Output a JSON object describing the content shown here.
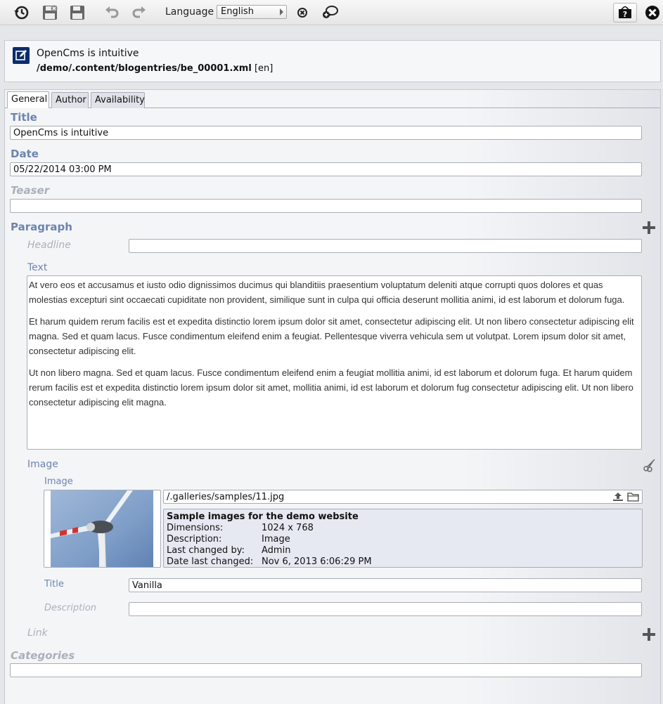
{
  "toolbar": {
    "language_label": "Language",
    "language_value": "English"
  },
  "header": {
    "title": "OpenCms is intuitive",
    "path": "/demo/.content/blogentries/be_00001.xml",
    "locale": "[en]"
  },
  "tabs": [
    {
      "label": "General",
      "active": true
    },
    {
      "label": "Author"
    },
    {
      "label": "Availability"
    }
  ],
  "fields": {
    "title_label": "Title",
    "title_value": "OpenCms is intuitive",
    "date_label": "Date",
    "date_value": "05/22/2014 03:00 PM",
    "teaser_label": "Teaser",
    "teaser_value": "",
    "paragraph_label": "Paragraph",
    "headline_label": "Headline",
    "headline_value": "",
    "text_label": "Text",
    "text_paragraphs": [
      "At vero eos et accusamus et iusto odio dignissimos ducimus qui blanditiis praesentium voluptatum deleniti atque corrupti quos dolores et quas molestias excepturi sint occaecati cupiditate non provident, similique sunt in culpa qui officia deserunt mollitia animi, id est laborum et dolorum fuga.",
      "Et harum quidem rerum facilis est et expedita distinctio lorem ipsum dolor sit amet, consectetur adipiscing elit. Ut non libero consectetur adipiscing elit magna. Sed et quam lacus. Fusce condimentum eleifend enim a feugiat. Pellentesque viverra vehicula sem ut volutpat. Lorem ipsum dolor sit amet, consectetur adipiscing elit.",
      "Ut non libero magna. Sed et quam lacus. Fusce condimentum eleifend enim a feugiat mollitia animi, id est laborum et dolorum fuga. Et harum quidem rerum facilis est et expedita distinctio lorem ipsum dolor sit amet, mollitia animi, id est laborum et dolorum fug consectetur adipiscing elit. Ut non libero consectetur adipiscing elit magna."
    ],
    "image_group_label": "Image",
    "image_label": "Image",
    "image_path": "/.galleries/samples/11.jpg",
    "image_info": {
      "heading": "Sample images for the demo website",
      "rows": [
        {
          "key": "Dimensions:",
          "value": "1024 x 768"
        },
        {
          "key": "Description:",
          "value": "Image"
        },
        {
          "key": "Last changed by:",
          "value": "Admin"
        },
        {
          "key": "Date last changed:",
          "value": "Nov 6, 2013 6:06:29 PM"
        }
      ]
    },
    "image_title_label": "Title",
    "image_title_value": "Vanilla",
    "image_description_label": "Description",
    "image_description_value": "",
    "link_label": "Link",
    "categories_label": "Categories",
    "categories_value": ""
  },
  "icons": [
    "history-icon",
    "save-exit-icon",
    "save-icon",
    "undo-icon",
    "redo-icon",
    "delete-locale-icon",
    "copy-locale-icon",
    "help-icon",
    "close-icon",
    "edit-icon",
    "add-icon",
    "cut-icon",
    "upload-icon",
    "folder-icon"
  ]
}
